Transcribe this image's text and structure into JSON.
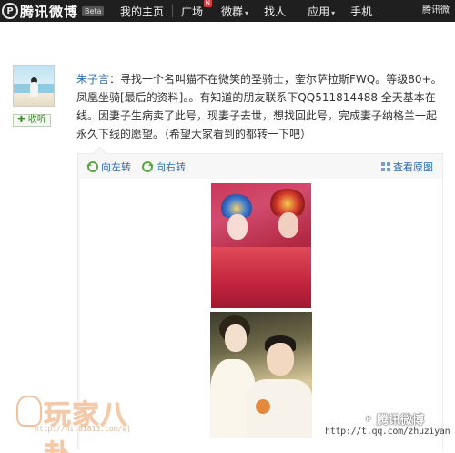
{
  "topbar": {
    "logo_mark": "P",
    "logo_text_1": "腾讯",
    "logo_text_2": "微博",
    "beta": "Beta",
    "nav": [
      {
        "label": "我的主页"
      },
      {
        "label": "广场",
        "badge": "N"
      },
      {
        "label": "微群",
        "caret": "▾"
      },
      {
        "label": "找人"
      },
      {
        "label": "应用",
        "caret": "▾"
      },
      {
        "label": "手机"
      }
    ],
    "user": "腾讯微"
  },
  "sidebar": {
    "follow_label": "✚ 收听"
  },
  "post": {
    "author": "朱子言",
    "separator": "：",
    "body": "寻找一个名叫猫不在微笑的圣骑士，奎尔萨拉斯FWQ。等级80+。凤凰坐骑[最后的资料]。。有知道的朋友联系下QQ511814488 全天基本在线。因妻子生病卖了此号，现妻子去世，想找回此号，完成妻子纳格兰一起永久下线的愿望。（希望大家看到的都转一下吧）",
    "tools": {
      "rotate_left": "向左转",
      "rotate_right": "向右转",
      "view_original": "查看原图"
    }
  },
  "watermarks": {
    "site_title": "玩家八卦",
    "site_url": "http://ni.81813.com/w]",
    "brand": "腾讯微博",
    "brand_mark": "P",
    "link": "http://t.qq.com/zhuziyan"
  },
  "colors": {
    "topbar_bg": "#1f1f1f",
    "link_blue": "#2b6cb5",
    "follow_green": "#3b8a2e",
    "rotate_icon_green": "#5aa642"
  }
}
